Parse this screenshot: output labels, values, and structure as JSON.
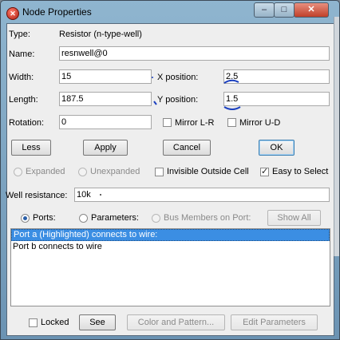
{
  "window": {
    "title": "Node Properties",
    "min_symbol": "–",
    "max_symbol": "□",
    "close_symbol": "✕",
    "icon_symbol": "✕"
  },
  "type_row": {
    "label": "Type:",
    "value": "Resistor (n-type-well)"
  },
  "name_row": {
    "label": "Name:",
    "value": "resnwell@0"
  },
  "width_row": {
    "label": "Width:",
    "value": "15",
    "xpos_label": "X position:",
    "xpos_value": "2.5"
  },
  "length_row": {
    "label": "Length:",
    "value": "187.5",
    "ypos_label": "Y position:",
    "ypos_value": "1.5"
  },
  "rotation_row": {
    "label": "Rotation:",
    "value": "0",
    "mirror_lr": "Mirror L-R",
    "mirror_ud": "Mirror U-D"
  },
  "buttons": {
    "less": "Less",
    "apply": "Apply",
    "cancel": "Cancel",
    "ok": "OK"
  },
  "expansion": {
    "expanded": "Expanded",
    "unexpanded": "Unexpanded",
    "invisible_outside_cell": "Invisible Outside Cell",
    "easy_to_select": "Easy to Select",
    "easy_to_select_checked": true
  },
  "well_resistance": {
    "label": "Well resistance:",
    "value": "10k"
  },
  "view_selector": {
    "ports": "Ports:",
    "parameters": "Parameters:",
    "bus_members": "Bus Members on Port:",
    "show_all": "Show All",
    "selected": "Ports"
  },
  "port_list": [
    "Port a (Highlighted) connects to wire:",
    "Port b connects to wire"
  ],
  "bottom": {
    "locked": "Locked",
    "see": "See",
    "color_and_pattern": "Color and Pattern...",
    "edit_parameters": "Edit Parameters"
  },
  "colors": {
    "accent": "#3b8ee3",
    "annotation": "#1a3fbf",
    "titlebar": "#7fa7c6"
  }
}
